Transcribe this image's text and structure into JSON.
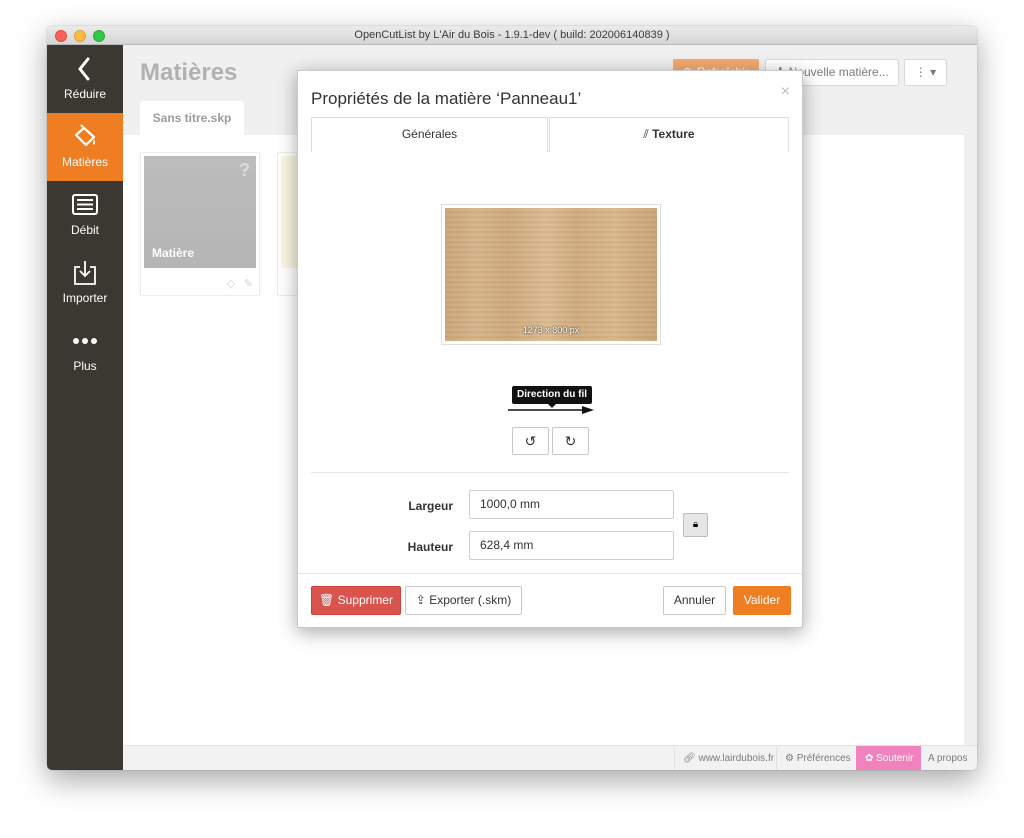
{
  "window": {
    "title": "OpenCutList by L'Air du Bois - 1.9.1-dev ( build: 202006140839 )",
    "traffic_colors": [
      "#fc605c",
      "#fdbc40",
      "#34c84a"
    ]
  },
  "sidebar": {
    "items": [
      {
        "label": "Réduire",
        "icon": "chevron-left-icon"
      },
      {
        "label": "Matières",
        "icon": "paint-bucket-icon"
      },
      {
        "label": "Débit",
        "icon": "list-icon"
      },
      {
        "label": "Importer",
        "icon": "import-icon"
      },
      {
        "label": "Plus",
        "icon": "more-dots-icon"
      }
    ]
  },
  "main": {
    "heading": "Matières",
    "tab_file": "Sans titre.skp",
    "toolbar": {
      "refresh_label": "Rafraîchir",
      "new_material_label": "Nouvelle matière...",
      "more_icon": "vertical-dots-icon"
    },
    "card": {
      "name": "Matière",
      "badge": "?"
    }
  },
  "modal": {
    "title": "Propriétés de la matière ‘Panneau1’",
    "close_glyph": "×",
    "tabs": [
      {
        "label": "Générales",
        "active": false
      },
      {
        "label": "Texture",
        "active": true
      }
    ],
    "texture_size": "1273 x 800 px",
    "grain_tooltip": "Direction du fil",
    "width_label": "Largeur",
    "width_value": "1000,0 mm",
    "height_label": "Hauteur",
    "height_value": "628,4 mm",
    "delete_label": "Supprimer",
    "export_label": "Exporter (.skm)",
    "cancel_label": "Annuler",
    "validate_label": "Valider"
  },
  "footer": {
    "website": "www.lairdubois.fr",
    "preferences": "Préférences",
    "support": "Soutenir",
    "about": "A propos"
  },
  "colors": {
    "accent": "#ef7d22",
    "sidebar_bg": "#3b3731",
    "danger": "#d9534f",
    "support": "#e8409c"
  }
}
